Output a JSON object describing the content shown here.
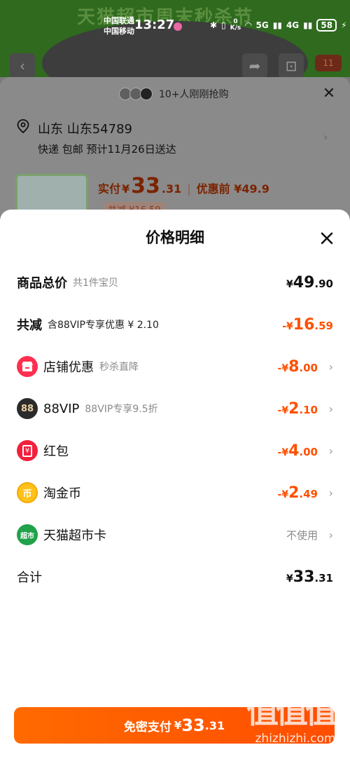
{
  "status_bar": {
    "carrier_1": "中国联通",
    "carrier_2": "中国移动",
    "time": "13:27",
    "network_speed": "0\nK/s",
    "signal_1": "5G",
    "signal_2": "4G",
    "battery": "58"
  },
  "background_page": {
    "banner_text": "天猫超市周末秒杀节",
    "cart_badge": "11"
  },
  "payment_sheet": {
    "buyers_text": "10+人刚刚抢购",
    "address": "山东 山东54789",
    "shipping": "快递 包邮 预计11月26日送达",
    "paid_label": "实付",
    "paid_currency": "¥",
    "paid_int": "33",
    "paid_dec": ".31",
    "before_discount": "优惠前 ¥49.9",
    "reduced_peek": "共减 ¥16.59"
  },
  "price_detail": {
    "title": "价格明细",
    "rows": [
      {
        "label": "商品总价",
        "sub": "共1件宝贝",
        "currency": "¥",
        "int": "49",
        "dec": ".90",
        "minus": false
      },
      {
        "label": "共减",
        "sub": "含88VIP专享优惠 ¥ 2.10",
        "currency": "-¥",
        "int": "16",
        "dec": ".59",
        "minus": true
      },
      {
        "label": "店铺优惠",
        "sub": "秒杀直降",
        "currency": "-¥",
        "int": "8",
        "dec": ".00",
        "minus": true,
        "icon": "shop-icon"
      },
      {
        "label": "88VIP",
        "sub": "88VIP专享9.5折",
        "currency": "-¥",
        "int": "2",
        "dec": ".10",
        "minus": true,
        "icon": "vip88-icon"
      },
      {
        "label": "红包",
        "sub": "",
        "currency": "-¥",
        "int": "4",
        "dec": ".00",
        "minus": true,
        "icon": "red-packet-icon"
      },
      {
        "label": "淘金币",
        "sub": "",
        "currency": "-¥",
        "int": "2",
        "dec": ".49",
        "minus": true,
        "icon": "taojinbi-icon"
      },
      {
        "label": "天猫超市卡",
        "sub": "",
        "value": "不使用",
        "icon": "supermarket-card-icon"
      },
      {
        "label": "合计",
        "sub": "",
        "currency": "¥",
        "int": "33",
        "dec": ".31",
        "minus": false
      }
    ],
    "vip_icon_text": "88",
    "red_packet_icon_text": "¥",
    "coin_icon_text": "币",
    "card_icon_text": "超市"
  },
  "pay_button": {
    "label": "免密支付",
    "currency": "¥",
    "int": "33",
    "dec": ".31"
  },
  "watermark": {
    "logo": "值值值",
    "url": "zhizhizhi.com"
  },
  "colors": {
    "accent": "#ff5000",
    "pay_button": "#ff5a00"
  }
}
